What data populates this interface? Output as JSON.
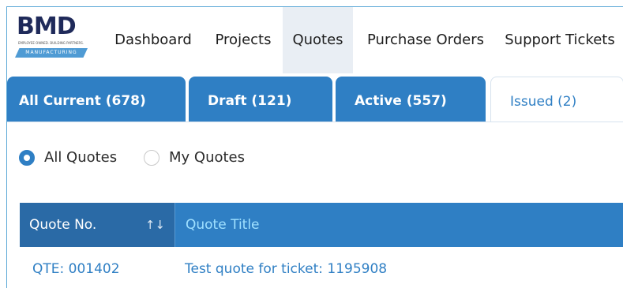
{
  "brand": {
    "logo_text": "BMD",
    "tagline": "EMPLOYEE OWNED. BUILDING PARTNERS.",
    "band_text": "MANUFACTURING",
    "accent": "#2f7fc4"
  },
  "nav": {
    "items": [
      {
        "label": "Dashboard"
      },
      {
        "label": "Projects"
      },
      {
        "label": "Quotes"
      },
      {
        "label": "Purchase Orders"
      },
      {
        "label": "Support Tickets"
      }
    ],
    "active": "Quotes"
  },
  "tabs": {
    "items": [
      {
        "label": "All Current (678)"
      },
      {
        "label": "Draft (121)"
      },
      {
        "label": "Active (557)"
      },
      {
        "label": "Issued (2)"
      }
    ],
    "active": "Issued (2)"
  },
  "filter": {
    "options": [
      {
        "label": "All Quotes",
        "selected": true
      },
      {
        "label": "My Quotes",
        "selected": false
      }
    ]
  },
  "table": {
    "columns": [
      {
        "label": "Quote No.",
        "sort_icon": "↑↓"
      },
      {
        "label": "Quote Title"
      }
    ],
    "rows": [
      {
        "quote_no": "QTE: 001402",
        "title": "Test quote for ticket: 1195908"
      }
    ]
  }
}
